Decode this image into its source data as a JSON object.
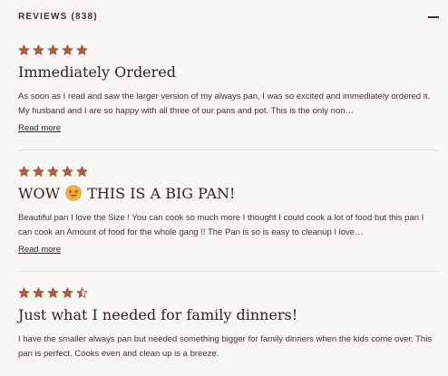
{
  "section": {
    "title": "REVIEWS (838)",
    "collapse_icon": "minus-icon"
  },
  "colors": {
    "star": "#b45a3c",
    "background": "#f9f7f3",
    "divider": "#e3ded7"
  },
  "reviews": [
    {
      "rating": 5,
      "title": "Immediately Ordered",
      "body": "As soon as I read and saw the larger version of my always pan, I was so excited and immediately ordered it. My husband and I are so happy with all three of our pans and pot. This is the only non…",
      "read_more": "Read more"
    },
    {
      "rating": 5,
      "title_before_emoji": "WOW",
      "emoji": "star-struck-emoji",
      "title_after_emoji": "THIS IS A BIG PAN!",
      "body": "Beautiful pan I love the Size ! You can cook so much more I thought I could cook a lot of food but this pan I can cook an Amount of food for the whole gang !! The Pan is so is easy to cleanup I love…",
      "read_more": "Read more"
    },
    {
      "rating": 4.5,
      "title": "Just what I needed for family dinners!",
      "body": "I have the smaller always pan but needed something bigger for family dinners when the kids come over. This pan is perfect. Cooks even and clean up is a breeze."
    }
  ]
}
